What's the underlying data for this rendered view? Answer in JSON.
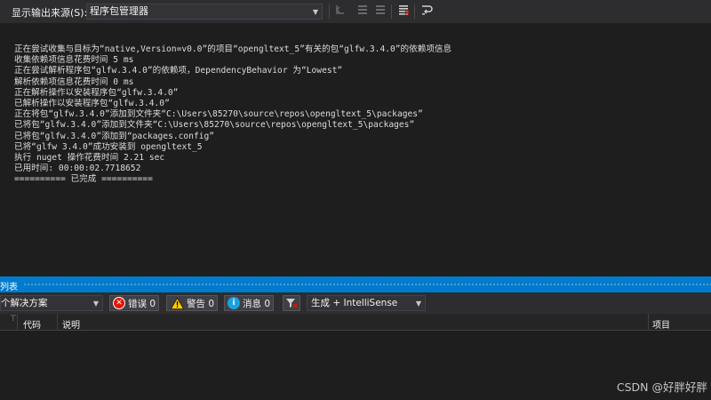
{
  "output": {
    "source_label": "显示输出来源(S):",
    "source_value": "程序包管理器",
    "lines": [
      "正在尝试收集与目标为“native,Version=v0.0”的项目“opengltext_5”有关的包“glfw.3.4.0”的依赖项信息",
      "收集依赖项信息花费时间 5 ms",
      "正在尝试解析程序包“glfw.3.4.0”的依赖项，DependencyBehavior 为“Lowest”",
      "解析依赖项信息花费时间 0 ms",
      "正在解析操作以安装程序包“glfw.3.4.0”",
      "已解析操作以安装程序包“glfw.3.4.0”",
      "正在将包“glfw.3.4.0”添加到文件夹“C:\\Users\\85270\\source\\repos\\opengltext_5\\packages”",
      "已将包“glfw.3.4.0”添加到文件夹“C:\\Users\\85270\\source\\repos\\opengltext_5\\packages”",
      "已将包“glfw.3.4.0”添加到“packages.config”",
      "已将“glfw 3.4.0”成功安装到 opengltext_5",
      "执行 nuget 操作花费时间 2.21 sec",
      "已用时间: 00:00:02.7718652",
      "========== 已完成 =========="
    ]
  },
  "error_list": {
    "title": "列表",
    "scope": "个解决方案",
    "errors_label": "错误 0",
    "warnings_label": "警告 0",
    "messages_label": "消息 0",
    "build_filter": "生成 + IntelliSense",
    "columns": {
      "code": "代码",
      "description": "说明",
      "project": "项目"
    }
  },
  "watermark": "CSDN @好胖好胖"
}
